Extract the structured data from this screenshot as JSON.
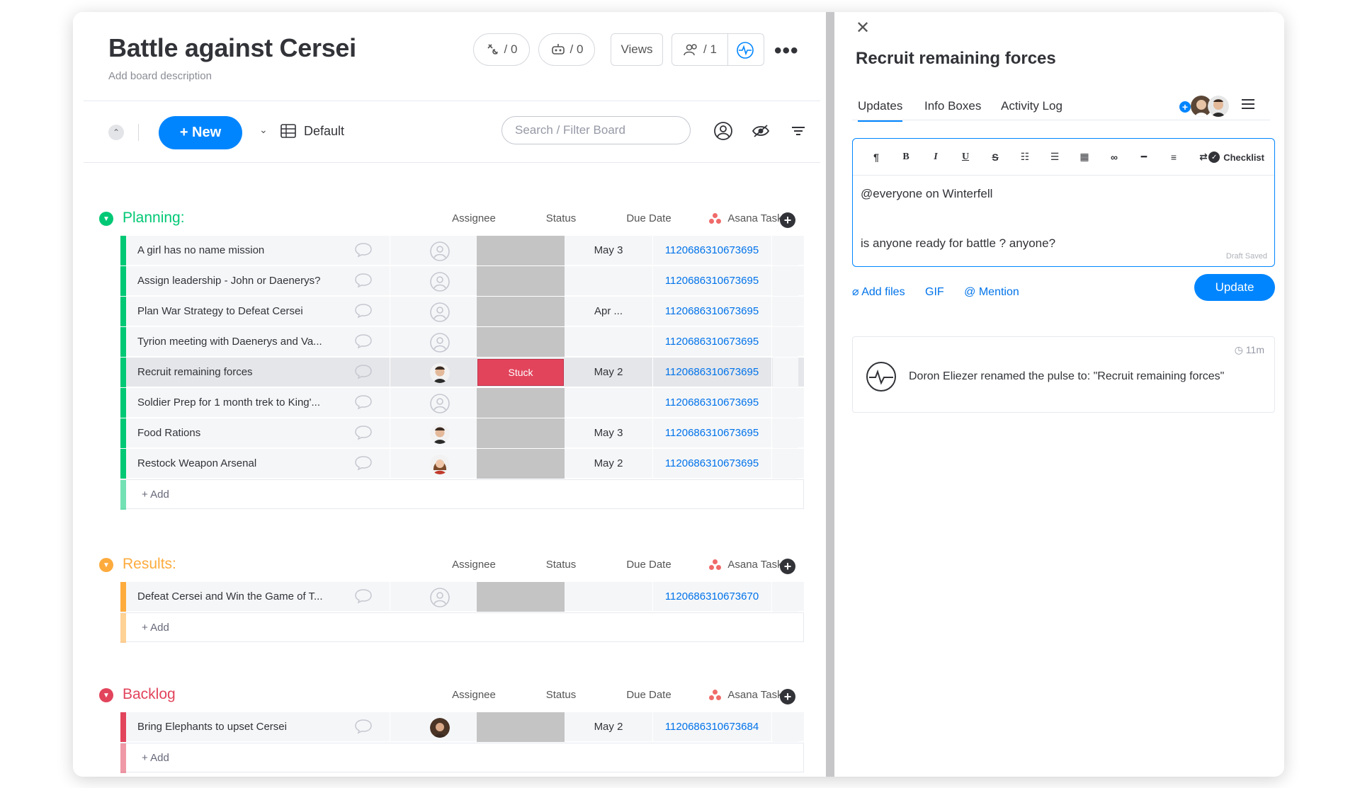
{
  "board": {
    "title": "Battle against Cersei",
    "description": "Add board description",
    "integrations_count": "/ 0",
    "automations_count": "/ 0",
    "views_label": "Views",
    "members_count": "/ 1"
  },
  "toolbar": {
    "new_label": "+ New",
    "view_name": "Default",
    "search_placeholder": "Search / Filter Board"
  },
  "columns": {
    "assignee": "Assignee",
    "status": "Status",
    "due_date": "Due Date",
    "asana": "Asana Task"
  },
  "colors": {
    "planning": "#00c875",
    "results": "#fdab3d",
    "backlog": "#e2445c",
    "accent": "#0085ff",
    "stuck": "#e2445c"
  },
  "groups": [
    {
      "title": "Planning:",
      "add_label": "+ Add",
      "rows": [
        {
          "name": "A girl has no name mission",
          "assignee": "empty",
          "status": "",
          "due": "May 3",
          "asana": "1120686310673695"
        },
        {
          "name": "Assign leadership - John or Daenerys?",
          "assignee": "empty",
          "status": "",
          "due": "",
          "asana": "1120686310673695"
        },
        {
          "name": "Plan War Strategy to Defeat Cersei",
          "assignee": "empty",
          "status": "",
          "due": "Apr ...",
          "asana": "1120686310673695"
        },
        {
          "name": "Tyrion meeting with Daenerys and Va...",
          "assignee": "empty",
          "status": "",
          "due": "",
          "asana": "1120686310673695"
        },
        {
          "name": "Recruit remaining forces",
          "assignee": "man",
          "status": "Stuck",
          "due": "May 2",
          "asana": "1120686310673695"
        },
        {
          "name": "Soldier Prep for 1 month trek to King'...",
          "assignee": "empty",
          "status": "",
          "due": "",
          "asana": "1120686310673695"
        },
        {
          "name": "Food Rations",
          "assignee": "man",
          "status": "",
          "due": "May 3",
          "asana": "1120686310673695"
        },
        {
          "name": "Restock Weapon Arsenal",
          "assignee": "woman",
          "status": "",
          "due": "May 2",
          "asana": "1120686310673695"
        }
      ]
    },
    {
      "title": "Results:",
      "add_label": "+ Add",
      "rows": [
        {
          "name": "Defeat Cersei and Win the Game of T...",
          "assignee": "empty",
          "status": "",
          "due": "",
          "asana": "1120686310673670"
        }
      ]
    },
    {
      "title": "Backlog",
      "add_label": "+ Add",
      "rows": [
        {
          "name": "Bring Elephants to upset Cersei",
          "assignee": "woman2",
          "status": "",
          "due": "May 2",
          "asana": "1120686310673684"
        }
      ]
    }
  ],
  "panel": {
    "title": "Recruit remaining forces",
    "tabs": [
      "Updates",
      "Info Boxes",
      "Activity Log"
    ],
    "checklist_label": "Checklist",
    "editor_line1": "@everyone on Winterfell",
    "editor_line2": "is anyone ready for battle ? anyone?",
    "draft_status": "Draft Saved",
    "add_files": "Add files",
    "gif": "GIF",
    "mention": "@ Mention",
    "update_label": "Update",
    "activity": {
      "time": "11m",
      "text": "Doron Eliezer renamed the pulse to: \"Recruit remaining forces\""
    }
  }
}
